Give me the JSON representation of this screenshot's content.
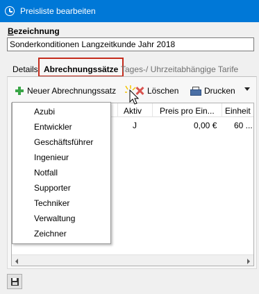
{
  "window": {
    "title": "Preisliste bearbeiten"
  },
  "form": {
    "label_bezeichnung_first": "B",
    "label_bezeichnung_rest": "ezeichnung",
    "bezeichnung_value": "Sonderkonditionen Langzeitkunde Jahr 2018"
  },
  "tabs": [
    {
      "label": "Details"
    },
    {
      "label": "Abrechnungssätze"
    },
    {
      "label": "Tages-/ Uhrzeitabhängige Tarife"
    }
  ],
  "toolbar": {
    "new_label": "Neuer Abrechnungssatz",
    "delete_label": "Löschen",
    "print_label": "Drucken"
  },
  "grid": {
    "columns": [
      "Aktiv",
      "Preis pro Ein...",
      "Einheit"
    ],
    "rows": [
      {
        "aktiv": "J",
        "preis": "0,00 €",
        "einheit": "60 ..."
      }
    ]
  },
  "dropdown": {
    "items": [
      "Azubi",
      "Entwickler",
      "Geschäftsführer",
      "Ingenieur",
      "Notfall",
      "Supporter",
      "Techniker",
      "Verwaltung",
      "Zeichner"
    ]
  },
  "icons": {
    "app": "clock-icon",
    "new": "plus-icon",
    "delete": "x-icon",
    "print": "printer-icon",
    "save": "floppy-disk-icon"
  },
  "colors": {
    "titlebar": "#0078d7",
    "tab_highlight": "#c42b1c",
    "plus": "#3aa547",
    "delete": "#d9534f"
  }
}
